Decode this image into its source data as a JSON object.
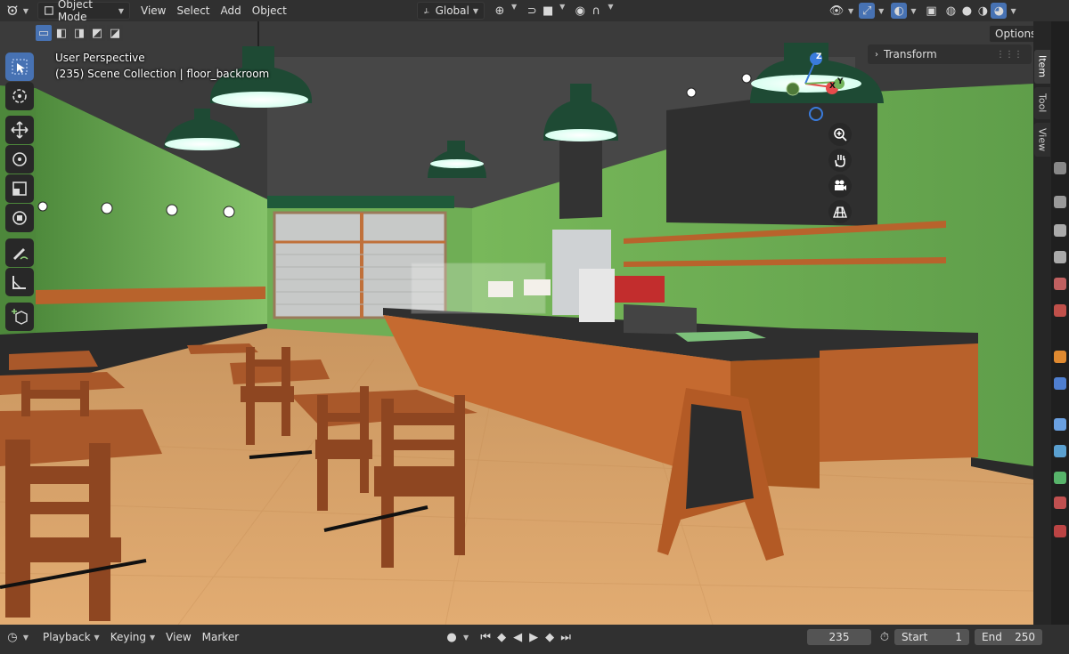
{
  "header": {
    "editor_icon": "viewport-editor-icon",
    "mode": "Object Mode",
    "menus": [
      "View",
      "Select",
      "Add",
      "Object"
    ],
    "transform_orientation": "Global",
    "options_label": "Options"
  },
  "viewport": {
    "info_line1": "User Perspective",
    "info_line2": "(235) Scene Collection | floor_backroom",
    "gizmo_axes": {
      "x": "X",
      "y": "Y",
      "z": "Z"
    }
  },
  "sidebar": {
    "tabs": [
      "Item",
      "Tool",
      "View"
    ],
    "panel_title": "Transform"
  },
  "timeline": {
    "menus": [
      "Playback",
      "Keying",
      "View",
      "Marker"
    ],
    "current_frame": "235",
    "start_label": "Start",
    "start_value": "1",
    "end_label": "End",
    "end_value": "250"
  },
  "colors": {
    "accent": "#4772b3",
    "header_bg": "#303030",
    "wall_green": "#5f9e4a",
    "floor_tan": "#d9a36a",
    "counter_orange": "#b8622c"
  }
}
